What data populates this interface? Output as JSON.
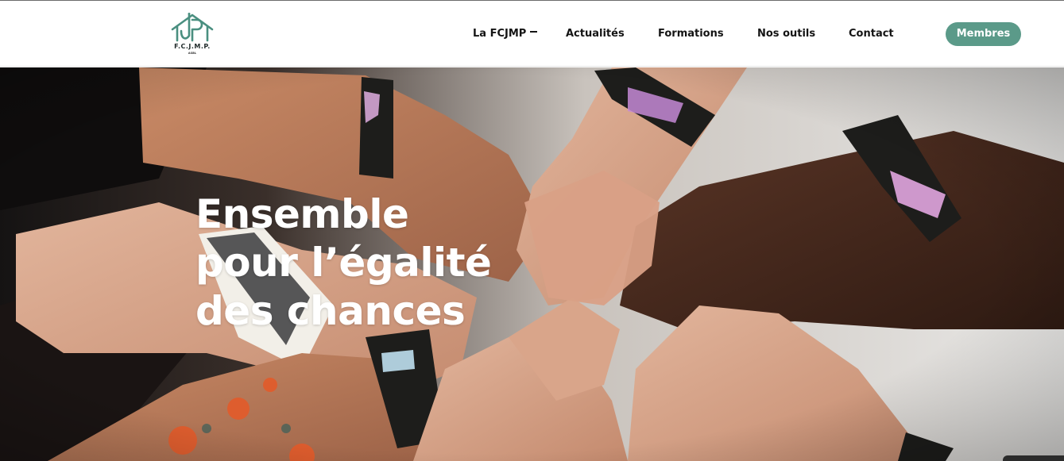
{
  "header": {
    "logo": {
      "text": "F.C.J.M.P.",
      "subtext": "ASBL",
      "icon": "house-people-logo-icon"
    },
    "nav": [
      {
        "label": "La FCJMP",
        "has_dropdown": true
      },
      {
        "label": "Actualités"
      },
      {
        "label": "Formations"
      },
      {
        "label": "Nos outils"
      },
      {
        "label": "Contact"
      }
    ],
    "cta": {
      "label": "Membres"
    }
  },
  "hero": {
    "title_lines": [
      "Ensemble",
      "pour l’égalité",
      "des chances"
    ],
    "image": "photo of raised fists wearing festival wristbands"
  },
  "colors": {
    "accent": "#5b9a89",
    "logo": "#4a8f80",
    "text": "#141414",
    "hero_text": "#ffffff"
  }
}
